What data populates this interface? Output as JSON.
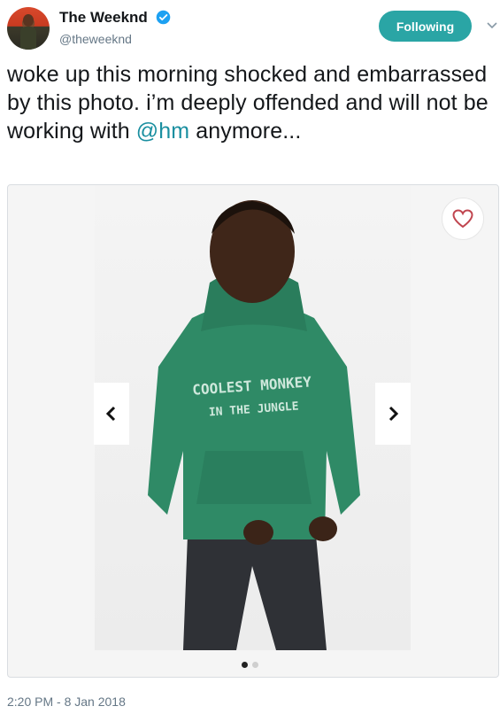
{
  "user": {
    "name": "The Weeknd",
    "handle": "@theweeknd"
  },
  "follow_button": {
    "label": "Following"
  },
  "tweet": {
    "text_before": "woke up this morning shocked and embarrassed by this photo. i’m deeply offended and will not be working with ",
    "mention": "@hm",
    "text_after": " anymore..."
  },
  "media": {
    "sweatshirt_line1": "COOLEST MONKEY",
    "sweatshirt_line2": "IN THE JUNGLE",
    "carousel_total": 2,
    "carousel_current": 1
  },
  "timestamp": "2:20 PM - 8 Jan 2018",
  "icons": {
    "verified": "verified-badge-icon",
    "caret": "chevron-down-icon",
    "heart": "heart-icon",
    "prev": "chevron-left-icon",
    "next": "chevron-right-icon"
  },
  "colors": {
    "follow_bg": "#2aa5a5",
    "mention": "#1a8fa0",
    "verified": "#1da1f2",
    "heart": "#c0454f"
  }
}
